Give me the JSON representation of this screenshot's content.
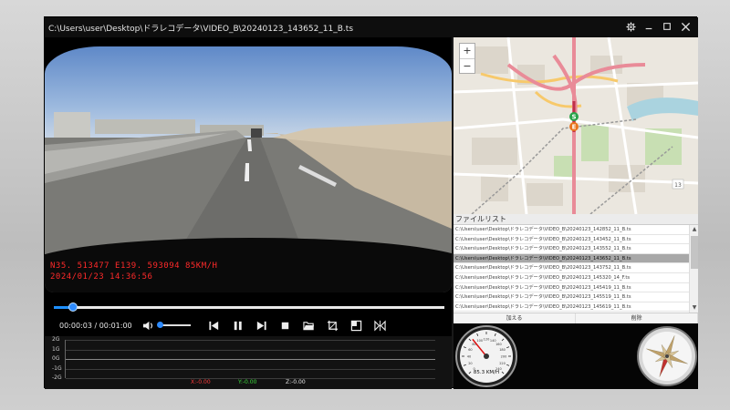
{
  "window": {
    "title": "C:\\Users\\user\\Desktop\\ドラレコデータ\\VIDEO_B\\20240123_143652_11_B.ts",
    "controls": [
      "gear-icon",
      "minimize-icon",
      "maximize-icon",
      "close-icon"
    ]
  },
  "video": {
    "osd_line1": "N35. 513477  E139. 593094  85KM/H",
    "osd_line2": "2024/01/23  14:36:56"
  },
  "playback": {
    "current_time": "00:00:03",
    "total_time": "00:01:00",
    "time_separator": " / ",
    "progress_fraction": 0.05,
    "volume_fraction": 0.05,
    "buttons": [
      "volume-icon",
      "skip-back-icon",
      "pause-icon",
      "skip-forward-icon",
      "stop-icon",
      "folder-open-icon",
      "crop-icon",
      "snapshot-icon",
      "flip-icon"
    ]
  },
  "gsensor": {
    "ticks": [
      "2G",
      "1G",
      "0G",
      "-1G",
      "-2G"
    ],
    "x_label": "X:-0.00",
    "y_label": "Y:-0.00",
    "z_label": "Z:-0.00",
    "x_color": "#ff3b3b",
    "y_color": "#3cdc3c",
    "z_color": "#e6e6e6"
  },
  "map": {
    "zoom_in": "+",
    "zoom_out": "−",
    "start_marker": "S",
    "end_marker": "E",
    "route_number": "13"
  },
  "filelist": {
    "header": "ファイルリスト",
    "items": [
      "C:\\Users\\user\\Desktop\\ドラレコデータ\\VIDEO_B\\20240123_142852_11_B.ts",
      "C:\\Users\\user\\Desktop\\ドラレコデータ\\VIDEO_B\\20240123_143452_11_B.ts",
      "C:\\Users\\user\\Desktop\\ドラレコデータ\\VIDEO_B\\20240123_143552_11_B.ts",
      "C:\\Users\\user\\Desktop\\ドラレコデータ\\VIDEO_B\\20240123_143652_11_B.ts",
      "C:\\Users\\user\\Desktop\\ドラレコデータ\\VIDEO_B\\20240123_143752_11_B.ts",
      "C:\\Users\\user\\Desktop\\ドラレコデータ\\VIDEO_B\\20240123_145320_14_F.ts",
      "C:\\Users\\user\\Desktop\\ドラレコデータ\\VIDEO_B\\20240123_145419_11_B.ts",
      "C:\\Users\\user\\Desktop\\ドラレコデータ\\VIDEO_B\\20240123_145519_11_B.ts",
      "C:\\Users\\user\\Desktop\\ドラレコデータ\\VIDEO_B\\20240123_145619_11_B.ts"
    ],
    "selected_index": 3,
    "add_button": "加える",
    "delete_button": "削除"
  },
  "speedometer": {
    "readout": "85.3 KM/H",
    "speed": 85.3,
    "max": 240,
    "tick_labels": [
      "0",
      "20",
      "40",
      "60",
      "80",
      "100",
      "120",
      "140",
      "160",
      "180",
      "200",
      "220",
      "240"
    ]
  },
  "compass": {
    "heading_deg": 200
  }
}
